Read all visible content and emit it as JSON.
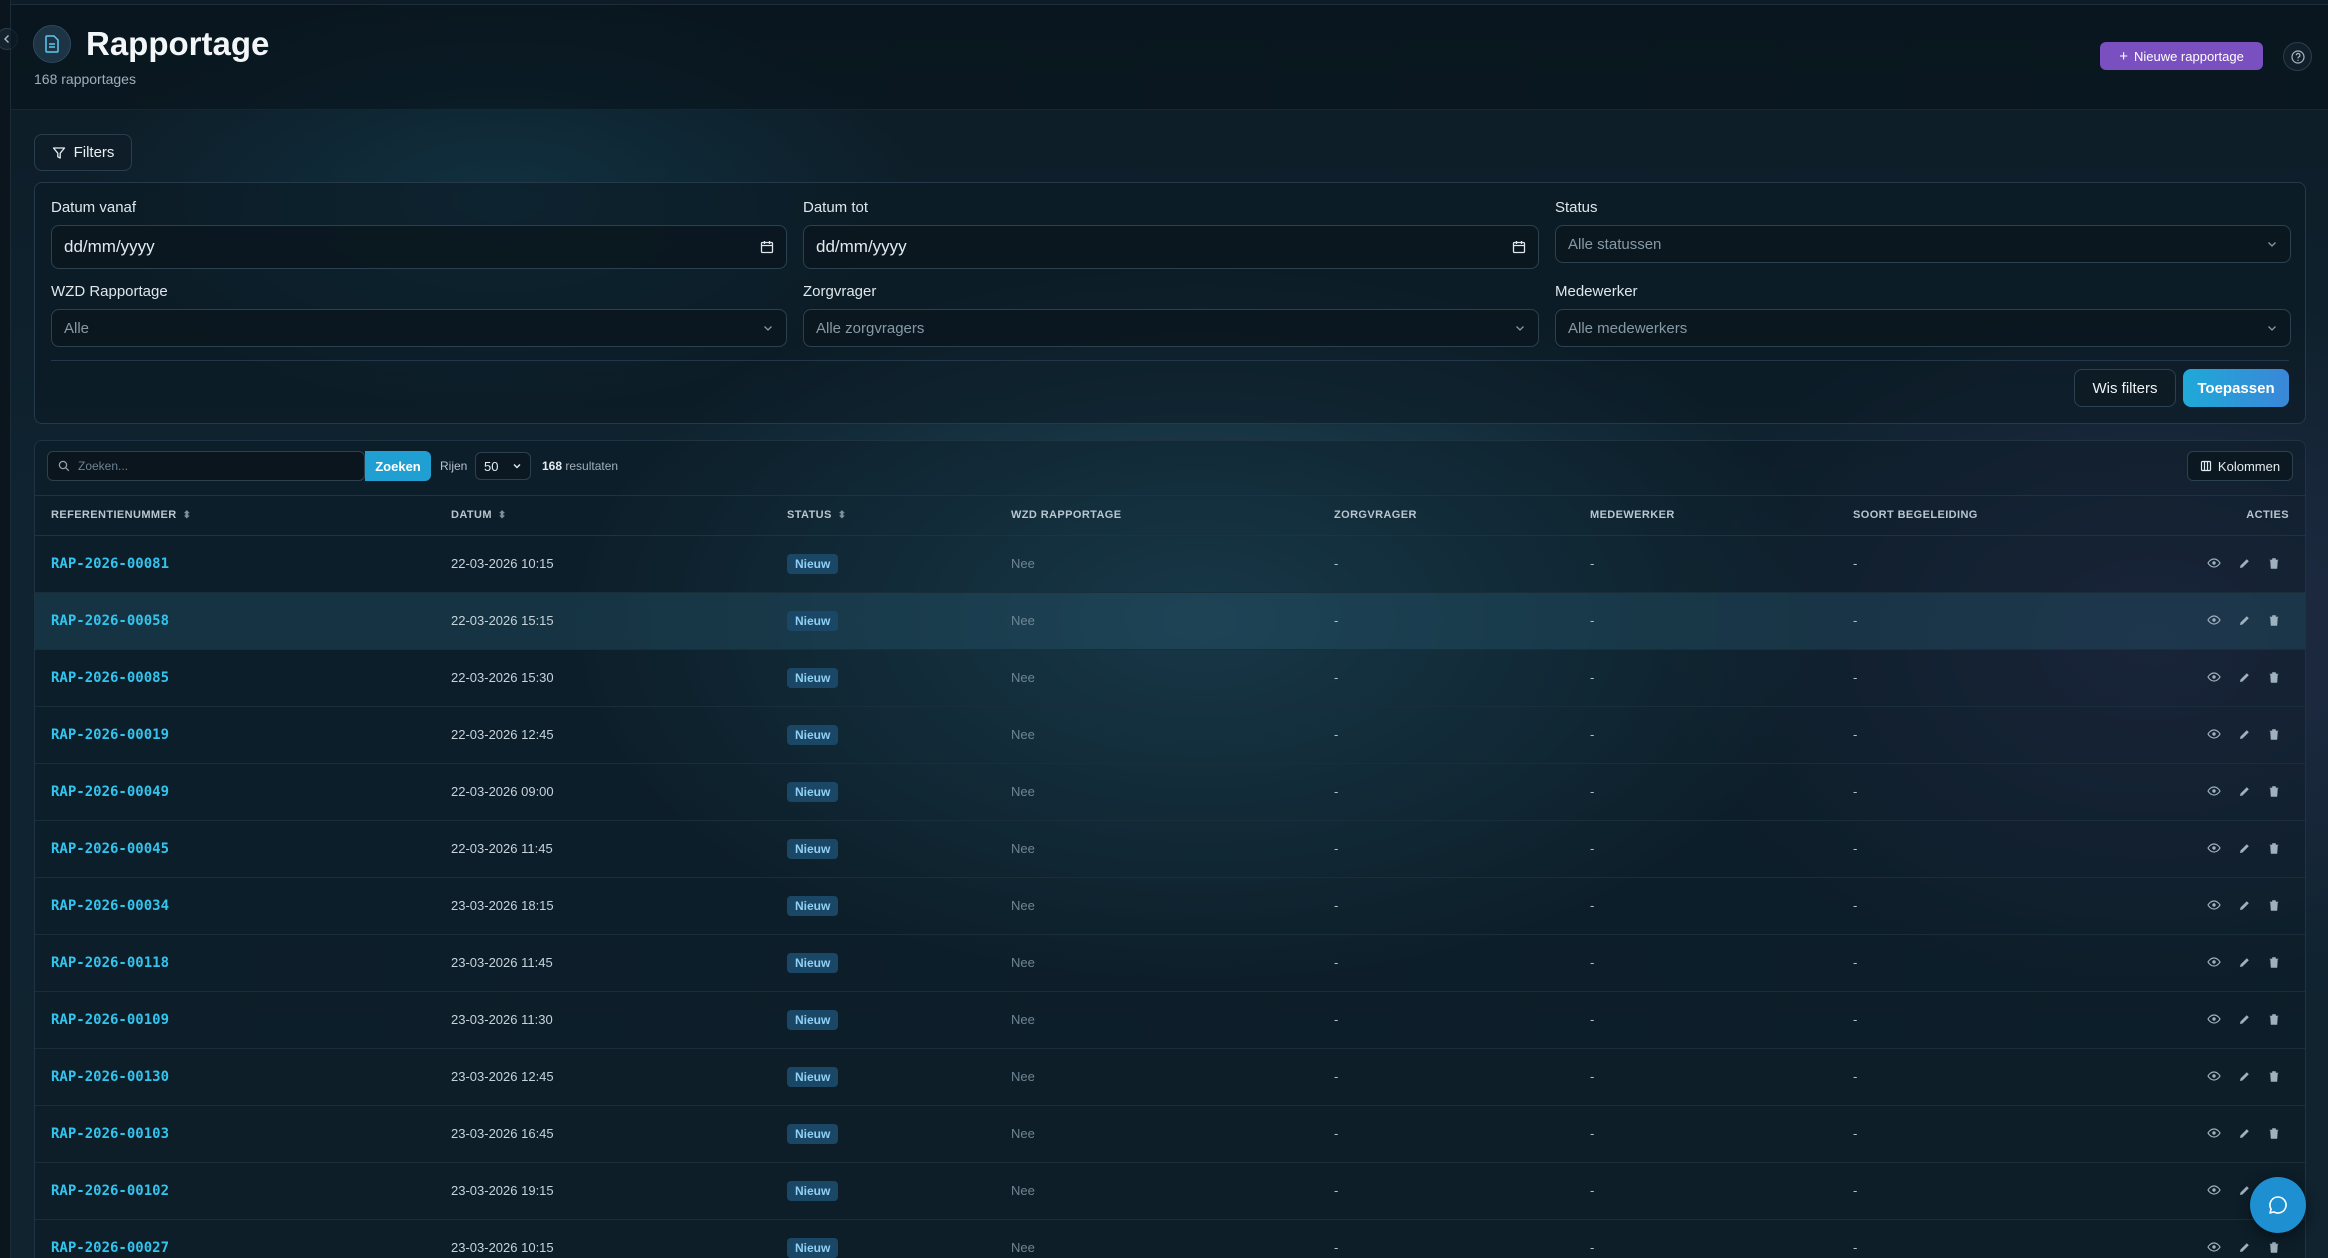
{
  "header": {
    "title": "Rapportage",
    "subtitle": "168 rapportages",
    "new_button": "Nieuwe rapportage"
  },
  "filters": {
    "toggle_label": "Filters",
    "date_from": {
      "label": "Datum vanaf",
      "placeholder": "dd/mm/yyyy"
    },
    "date_to": {
      "label": "Datum tot",
      "placeholder": "dd/mm/yyyy"
    },
    "status": {
      "label": "Status",
      "value": "Alle statussen"
    },
    "wzd": {
      "label": "WZD Rapportage",
      "value": "Alle"
    },
    "client": {
      "label": "Zorgvrager",
      "value": "Alle zorgvragers"
    },
    "employee": {
      "label": "Medewerker",
      "value": "Alle medewerkers"
    },
    "clear_label": "Wis filters",
    "apply_label": "Toepassen"
  },
  "toolbar": {
    "search_placeholder": "Zoeken...",
    "search_button": "Zoeken",
    "rows_label": "Rijen",
    "rows_value": "50",
    "results_count": "168",
    "results_label": "resultaten",
    "columns_label": "Kolommen"
  },
  "table": {
    "columns": [
      "REFERENTIENUMMER",
      "DATUM",
      "STATUS",
      "WZD RAPPORTAGE",
      "ZORGVRAGER",
      "MEDEWERKER",
      "SOORT BEGELEIDING",
      "ACTIES"
    ],
    "rows": [
      {
        "ref": "RAP-2026-00081",
        "date": "22-03-2026 10:15",
        "status": "Nieuw",
        "wzd": "Nee",
        "client": "-",
        "employee": "-",
        "type": "-"
      },
      {
        "ref": "RAP-2026-00058",
        "date": "22-03-2026 15:15",
        "status": "Nieuw",
        "wzd": "Nee",
        "client": "-",
        "employee": "-",
        "type": "-"
      },
      {
        "ref": "RAP-2026-00085",
        "date": "22-03-2026 15:30",
        "status": "Nieuw",
        "wzd": "Nee",
        "client": "-",
        "employee": "-",
        "type": "-"
      },
      {
        "ref": "RAP-2026-00019",
        "date": "22-03-2026 12:45",
        "status": "Nieuw",
        "wzd": "Nee",
        "client": "-",
        "employee": "-",
        "type": "-"
      },
      {
        "ref": "RAP-2026-00049",
        "date": "22-03-2026 09:00",
        "status": "Nieuw",
        "wzd": "Nee",
        "client": "-",
        "employee": "-",
        "type": "-"
      },
      {
        "ref": "RAP-2026-00045",
        "date": "22-03-2026 11:45",
        "status": "Nieuw",
        "wzd": "Nee",
        "client": "-",
        "employee": "-",
        "type": "-"
      },
      {
        "ref": "RAP-2026-00034",
        "date": "23-03-2026 18:15",
        "status": "Nieuw",
        "wzd": "Nee",
        "client": "-",
        "employee": "-",
        "type": "-"
      },
      {
        "ref": "RAP-2026-00118",
        "date": "23-03-2026 11:45",
        "status": "Nieuw",
        "wzd": "Nee",
        "client": "-",
        "employee": "-",
        "type": "-"
      },
      {
        "ref": "RAP-2026-00109",
        "date": "23-03-2026 11:30",
        "status": "Nieuw",
        "wzd": "Nee",
        "client": "-",
        "employee": "-",
        "type": "-"
      },
      {
        "ref": "RAP-2026-00130",
        "date": "23-03-2026 12:45",
        "status": "Nieuw",
        "wzd": "Nee",
        "client": "-",
        "employee": "-",
        "type": "-"
      },
      {
        "ref": "RAP-2026-00103",
        "date": "23-03-2026 16:45",
        "status": "Nieuw",
        "wzd": "Nee",
        "client": "-",
        "employee": "-",
        "type": "-"
      },
      {
        "ref": "RAP-2026-00102",
        "date": "23-03-2026 19:15",
        "status": "Nieuw",
        "wzd": "Nee",
        "client": "-",
        "employee": "-",
        "type": "-"
      },
      {
        "ref": "RAP-2026-00027",
        "date": "23-03-2026 10:15",
        "status": "Nieuw",
        "wzd": "Nee",
        "client": "-",
        "employee": "-",
        "type": "-"
      }
    ]
  },
  "colors": {
    "accent_cyan": "#33c4ee",
    "primary_purple": "#7a4fc0",
    "apply_blue": "#1fa9d8",
    "badge_bg": "#1b4766"
  }
}
